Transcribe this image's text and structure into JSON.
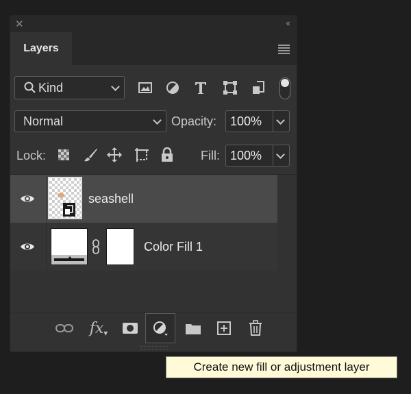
{
  "panel": {
    "tab_label": "Layers"
  },
  "filter": {
    "kind_label": "Kind"
  },
  "blend": {
    "mode": "Normal",
    "opacity_label": "Opacity:",
    "opacity_value": "100%"
  },
  "lock": {
    "label": "Lock:",
    "fill_label": "Fill:",
    "fill_value": "100%"
  },
  "layers": [
    {
      "name": "seashell",
      "visible": true,
      "selected": true
    },
    {
      "name": "Color Fill 1",
      "visible": true,
      "selected": false
    }
  ],
  "bottom_toolbar": {
    "fx_label": "fx"
  },
  "tooltip": {
    "text": "Create new fill or adjustment layer"
  },
  "colors": {
    "panel_bg": "#323232",
    "selected_row": "#4a4a4a",
    "tooltip_bg": "#fffbd9"
  }
}
